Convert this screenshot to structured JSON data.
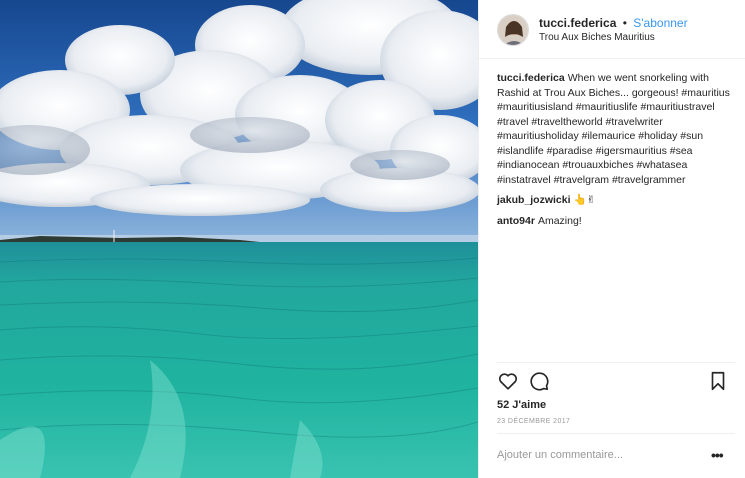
{
  "post": {
    "username": "tucci.federica",
    "separator": "•",
    "follow_label": "S'abonner",
    "location": "Trou Aux Biches Mauritius"
  },
  "comments": [
    {
      "user": "tucci.federica",
      "text": "When we went snorkeling with Rashid at Trou Aux Biches... gorgeous! #mauritius #mauritiusisland #mauritiuslife #mauritiustravel #travel #traveltheworld #travelwriter #mauritiusholiday #ilemaurice #holiday #sun #islandlife #paradise #igersmauritius #sea #indianocean #trouauxbiches #whatasea #instatravel #travelgram #travelgrammer"
    },
    {
      "user": "jakub_jozwicki",
      "text": "👆✌"
    },
    {
      "user": "anto94r",
      "text": "Amazing!"
    }
  ],
  "actions": {
    "like_icon": "heart-icon",
    "comment_icon": "comment-icon",
    "save_icon": "bookmark-icon"
  },
  "likes": "52 J'aime",
  "date": "23 DÉCEMBRE 2017",
  "add_comment_placeholder": "Ajouter un commentaire...",
  "more_label": "•••",
  "colors": {
    "accent": "#3897f0",
    "text": "#262626",
    "muted": "#999999",
    "sea": "#2aa79b",
    "sky": "#1f5fae"
  }
}
